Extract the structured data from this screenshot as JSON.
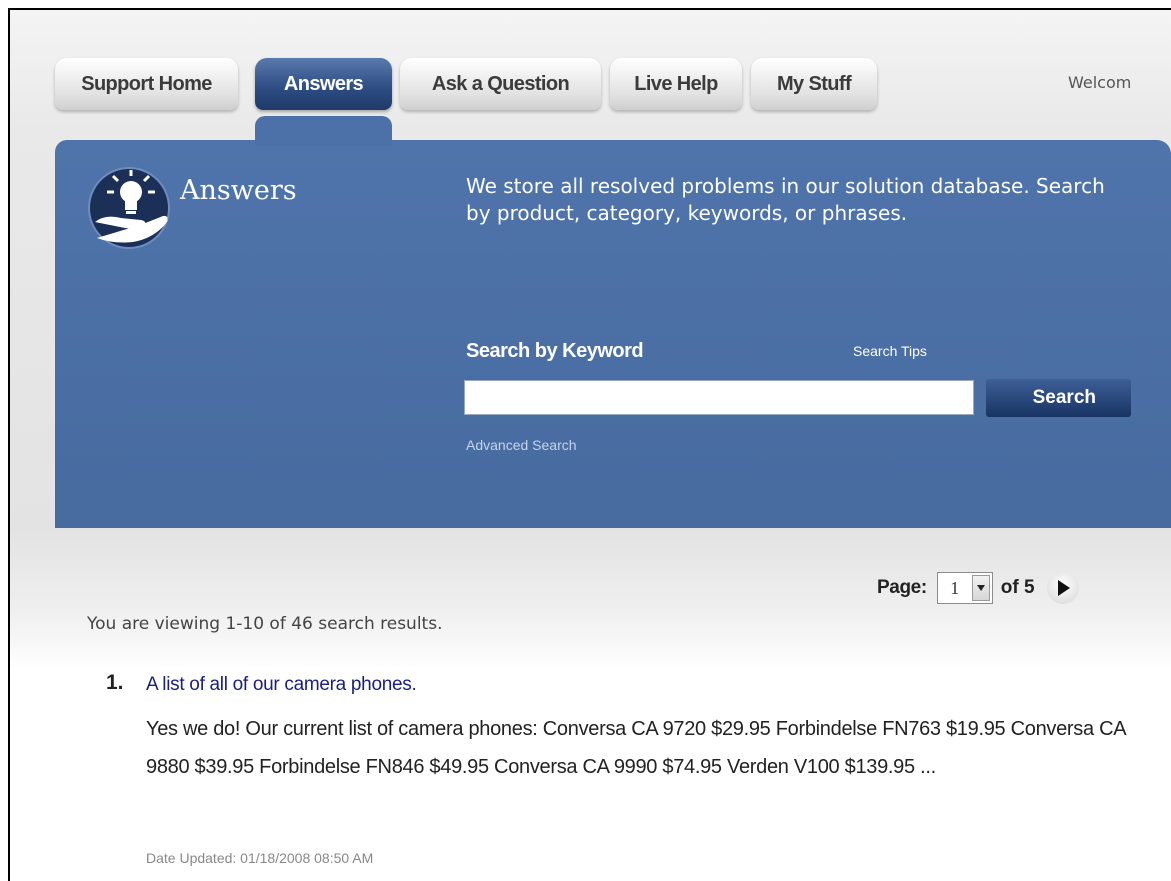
{
  "nav": {
    "tabs": [
      {
        "label": "Support Home",
        "active": false
      },
      {
        "label": "Answers",
        "active": true
      },
      {
        "label": "Ask a Question",
        "active": false
      },
      {
        "label": "Live Help",
        "active": false
      },
      {
        "label": "My Stuff",
        "active": false
      }
    ],
    "welcome_text": "Welcom"
  },
  "hero": {
    "title": "Answers",
    "icon": "lightbulb-hand-icon",
    "description": "We store all resolved problems in our solution database. Search by product, category, keywords, or phrases."
  },
  "search": {
    "label": "Search by Keyword",
    "tips_link": "Search Tips",
    "input_value": "",
    "button_label": "Search",
    "advanced_link": "Advanced Search"
  },
  "pagination": {
    "label": "Page:",
    "current_page": "1",
    "total_label": "of 5"
  },
  "results": {
    "summary": "You are viewing 1-10 of 46 search results.",
    "items": [
      {
        "number": "1.",
        "title": "A list of all of our camera phones.",
        "snippet": "Yes we do! Our current list of camera phones: Conversa CA 9720 $29.95 Forbindelse FN763 $19.95 Conversa CA 9880 $39.95 Forbindelse FN846 $49.95 Conversa CA 9990 $74.95 Verden V100 $139.95 ...",
        "date": "Date Updated: 01/18/2008 08:50 AM"
      }
    ]
  },
  "colors": {
    "banner": "#4c71a8",
    "active_tab": "#2c4c82",
    "link": "#1a1f7a"
  }
}
